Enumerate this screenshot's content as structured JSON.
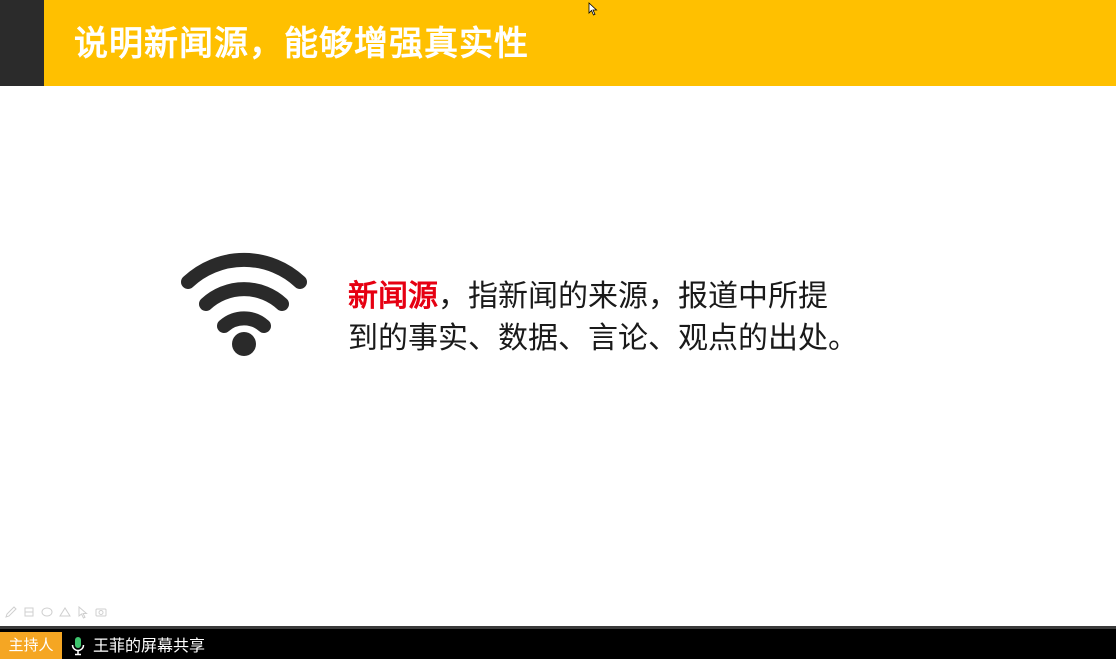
{
  "slide": {
    "title": "说明新闻源，能够增强真实性",
    "body_highlight": "新闻源",
    "body_line1_rest": "，指新闻的来源，报道中所提",
    "body_line2": "到的事实、数据、言论、观点的出处。",
    "icon": "wifi-icon",
    "colors": {
      "header_bg": "#ffc000",
      "header_accent": "#2b2b2b",
      "highlight": "#e60012"
    }
  },
  "annotation_tools": [
    "pen-icon",
    "highlighter-icon",
    "eraser-icon",
    "shape-icon",
    "pointer-icon",
    "camera-icon"
  ],
  "status_bar": {
    "host_label": "主持人",
    "share_label": "王菲的屏幕共享",
    "mic_icon": "microphone-icon",
    "colors": {
      "host_badge": "#f5a623",
      "bar_bg": "#000000"
    }
  }
}
